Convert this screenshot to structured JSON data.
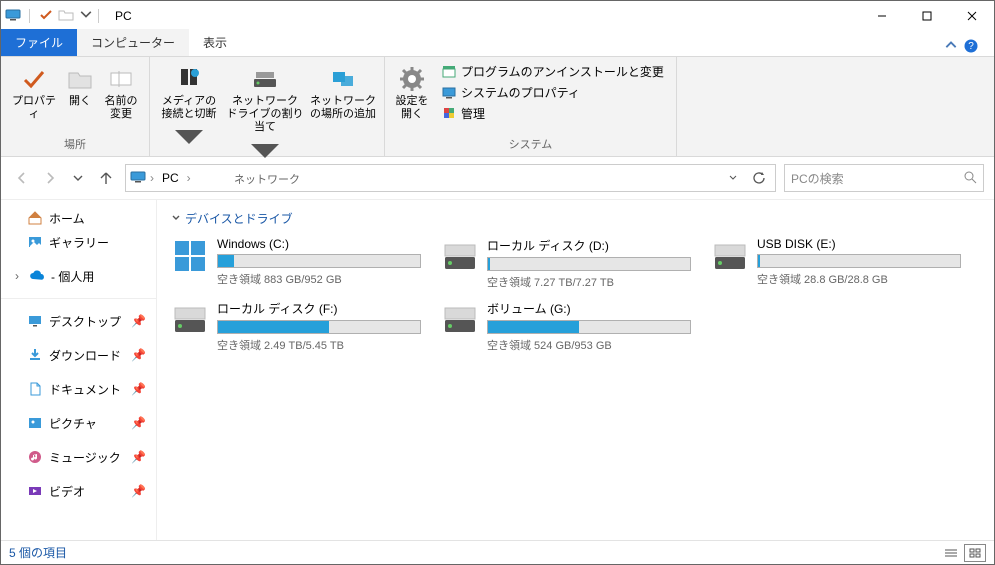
{
  "title": "PC",
  "tabs": {
    "file": "ファイル",
    "computer": "コンピューター",
    "view": "表示"
  },
  "ribbon": {
    "location_group": {
      "properties": "プロパティ",
      "open": "開く",
      "rename": "名前の変更",
      "label": "場所"
    },
    "network_group": {
      "media": "メディアの接続と切断",
      "mapdrive": "ネットワーク ドライブの割り当て",
      "addloc": "ネットワークの場所の追加",
      "label": "ネットワーク"
    },
    "system_group": {
      "settings": "設定を開く",
      "uninstall": "プログラムのアンインストールと変更",
      "sysprops": "システムのプロパティ",
      "manage": "管理",
      "label": "システム"
    }
  },
  "nav": {
    "location": "PC"
  },
  "search": {
    "placeholder": "PCの検索"
  },
  "sidebar": {
    "quick": [
      {
        "icon": "home",
        "label": "ホーム"
      },
      {
        "icon": "gallery",
        "label": "ギャラリー"
      }
    ],
    "cloud": {
      "label": "- 個人用"
    },
    "pinned": [
      {
        "icon": "desktop",
        "label": "デスクトップ"
      },
      {
        "icon": "download",
        "label": "ダウンロード"
      },
      {
        "icon": "document",
        "label": "ドキュメント"
      },
      {
        "icon": "picture",
        "label": "ピクチャ"
      },
      {
        "icon": "music",
        "label": "ミュージック"
      },
      {
        "icon": "video",
        "label": "ビデオ"
      }
    ]
  },
  "content": {
    "group_header": "デバイスとドライブ",
    "drives": [
      {
        "icon": "winlogo",
        "name": "Windows (C:)",
        "free": "空き領域 883 GB/952 GB",
        "fill": 8
      },
      {
        "icon": "hdd",
        "name": "ローカル ディスク (D:)",
        "free": "空き領域 7.27 TB/7.27 TB",
        "fill": 1
      },
      {
        "icon": "hdd",
        "name": "USB DISK (E:)",
        "free": "空き領域 28.8 GB/28.8 GB",
        "fill": 1
      },
      {
        "icon": "hdd",
        "name": "ローカル ディスク (F:)",
        "free": "空き領域 2.49 TB/5.45 TB",
        "fill": 55
      },
      {
        "icon": "hdd",
        "name": "ボリューム (G:)",
        "free": "空き領域 524 GB/953 GB",
        "fill": 45
      }
    ]
  },
  "status": {
    "text": "5 個の項目"
  }
}
